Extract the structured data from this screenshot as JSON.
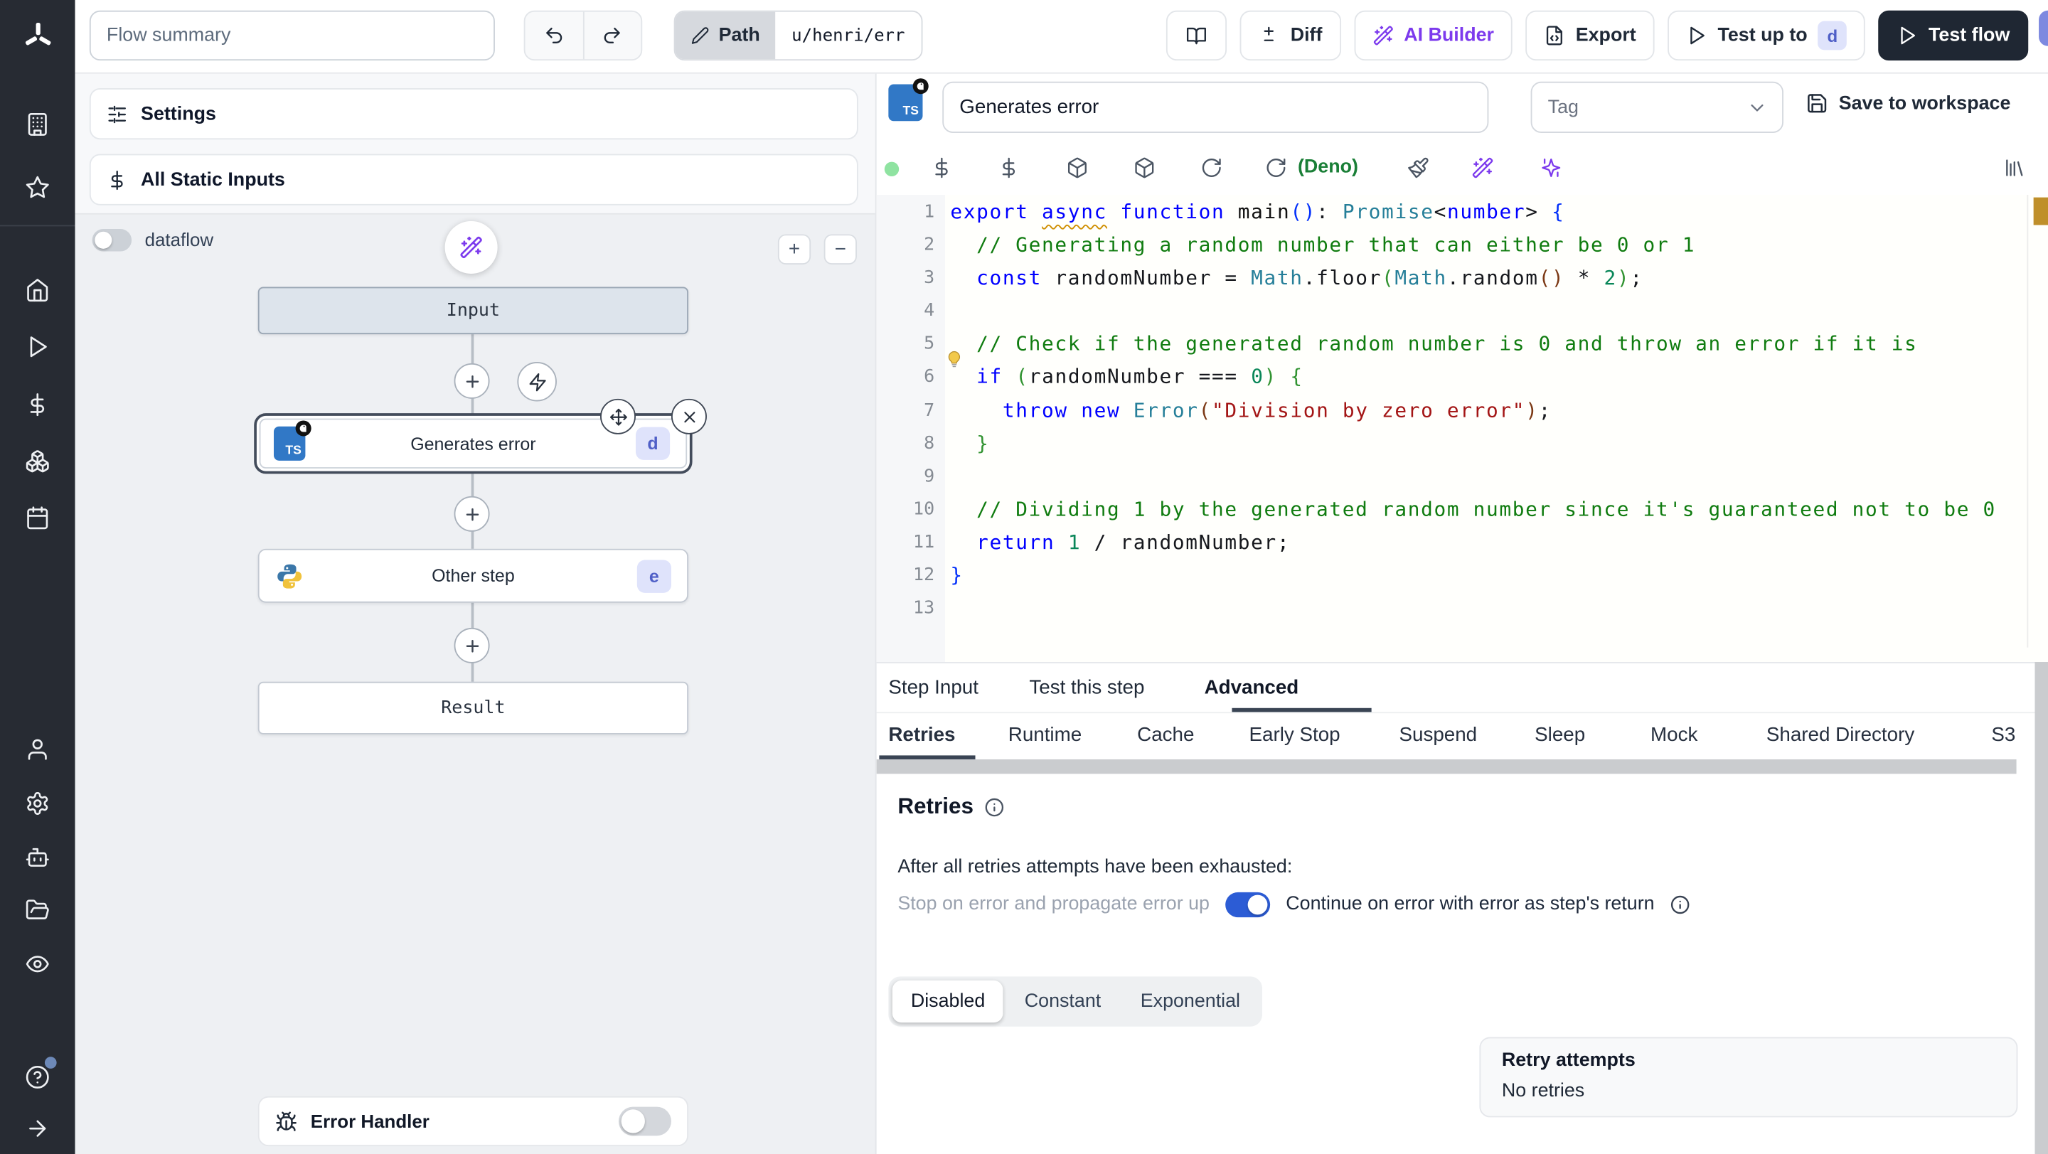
{
  "topbar": {
    "flow_summary_placeholder": "Flow summary",
    "path_label": "Path",
    "path_value": "u/henri/err",
    "diff_label": "Diff",
    "ai_builder_label": "AI Builder",
    "export_label": "Export",
    "test_up_to_label": "Test up to",
    "test_up_to_badge": "d",
    "test_flow_label": "Test flow"
  },
  "flow_panel": {
    "settings_label": "Settings",
    "static_inputs_label": "All Static Inputs",
    "dataflow_label": "dataflow",
    "zoom_in_label": "+",
    "zoom_out_label": "−",
    "nodes": {
      "input": {
        "label": "Input"
      },
      "generates_error": {
        "label": "Generates error",
        "badge": "d"
      },
      "other_step": {
        "label": "Other step",
        "badge": "e"
      },
      "result": {
        "label": "Result"
      }
    },
    "error_handler_label": "Error Handler"
  },
  "step_editor": {
    "ts_badge": "TS",
    "name_value": "Generates error",
    "tag_placeholder": "Tag",
    "save_label": "Save to workspace",
    "runtime_label": "(Deno)",
    "code": {
      "language": "typescript",
      "lines": [
        [
          [
            "kw",
            "export"
          ],
          [
            "pl",
            " "
          ],
          [
            "kw-warn",
            "async"
          ],
          [
            "pl",
            " "
          ],
          [
            "kw",
            "function"
          ],
          [
            "pl",
            " "
          ],
          [
            "fn",
            "main"
          ],
          [
            "b1",
            "("
          ],
          [
            "b1",
            ")"
          ],
          [
            "pl",
            ": "
          ],
          [
            "ty",
            "Promise"
          ],
          [
            "pl",
            "<"
          ],
          [
            "kw",
            "number"
          ],
          [
            "pl",
            "> "
          ],
          [
            "b1",
            "{"
          ]
        ],
        [
          [
            "pl",
            "  "
          ],
          [
            "cm",
            "// Generating a random number that can either be 0 or 1"
          ]
        ],
        [
          [
            "pl",
            "  "
          ],
          [
            "kw",
            "const"
          ],
          [
            "pl",
            " randomNumber = "
          ],
          [
            "ty",
            "Math"
          ],
          [
            "pl",
            ".floor"
          ],
          [
            "b2",
            "("
          ],
          [
            "ty",
            "Math"
          ],
          [
            "pl",
            ".random"
          ],
          [
            "b3",
            "()"
          ],
          [
            "pl",
            " * "
          ],
          [
            "nu",
            "2"
          ],
          [
            "b2",
            ")"
          ],
          [
            "pl",
            ";"
          ]
        ],
        [],
        [
          [
            "pl",
            "  "
          ],
          [
            "cm",
            "// Check if the generated random number is 0 and throw an error if it is"
          ]
        ],
        [
          [
            "pl",
            "  "
          ],
          [
            "kw",
            "if"
          ],
          [
            "pl",
            " "
          ],
          [
            "b2",
            "("
          ],
          [
            "pl",
            "randomNumber === "
          ],
          [
            "nu",
            "0"
          ],
          [
            "b2",
            ")"
          ],
          [
            "pl",
            " "
          ],
          [
            "b2",
            "{"
          ]
        ],
        [
          [
            "pl",
            "    "
          ],
          [
            "kw",
            "throw"
          ],
          [
            "pl",
            " "
          ],
          [
            "kw",
            "new"
          ],
          [
            "pl",
            " "
          ],
          [
            "ty",
            "Error"
          ],
          [
            "b3",
            "("
          ],
          [
            "st",
            "\"Division by zero error\""
          ],
          [
            "b3",
            ")"
          ],
          [
            "pl",
            ";"
          ]
        ],
        [
          [
            "pl",
            "  "
          ],
          [
            "b2",
            "}"
          ]
        ],
        [],
        [
          [
            "pl",
            "  "
          ],
          [
            "cm",
            "// Dividing 1 by the generated random number since it's guaranteed not to be 0"
          ]
        ],
        [
          [
            "pl",
            "  "
          ],
          [
            "kw",
            "return"
          ],
          [
            "pl",
            " "
          ],
          [
            "nu",
            "1"
          ],
          [
            "pl",
            " / randomNumber;"
          ]
        ],
        [
          [
            "b1",
            "}"
          ]
        ],
        []
      ]
    },
    "tabs": [
      "Step Input",
      "Test this step",
      "Advanced"
    ],
    "active_tab": "Advanced",
    "subtabs": [
      "Retries",
      "Runtime",
      "Cache",
      "Early Stop",
      "Suspend",
      "Sleep",
      "Mock",
      "Shared Directory",
      "S3"
    ],
    "active_subtab": "Retries",
    "retries": {
      "title": "Retries",
      "exhausted_label": "After all retries attempts have been exhausted:",
      "stop_label": "Stop on error and propagate error up",
      "continue_label": "Continue on error with error as step's return",
      "strategies": [
        "Disabled",
        "Constant",
        "Exponential"
      ],
      "active_strategy": "Disabled",
      "retry_attempts_title": "Retry attempts",
      "retry_attempts_value": "No retries"
    }
  },
  "icon_names": {
    "sidebar": [
      "windmill-logo",
      "building",
      "star",
      "home",
      "play",
      "dollar-sign",
      "boxes",
      "calendar",
      "user",
      "settings-gear",
      "robot",
      "folder-open",
      "eye",
      "help-circle",
      "arrow-right"
    ],
    "topbar": [
      "undo",
      "redo",
      "pencil",
      "book-open",
      "diff-plus-minus",
      "magic-wand",
      "file-code",
      "play-triangle"
    ],
    "editor_toolbar": [
      "status-dot",
      "dollar-sign",
      "dollar-sign",
      "package",
      "package",
      "reload",
      "reload",
      "paintbrush",
      "magic-wand",
      "sparkles",
      "library"
    ]
  },
  "colors": {
    "accent_purple": "#7c3aed",
    "toggle_on_blue": "#2c5cd5",
    "badge_bg": "#dfe3fb",
    "badge_text": "#4f5fc7",
    "deno_green": "#1a7f37",
    "ts_blue": "#3178c6",
    "sidebar_bg": "#272b33",
    "overview_marker": "#bf8f2a"
  }
}
